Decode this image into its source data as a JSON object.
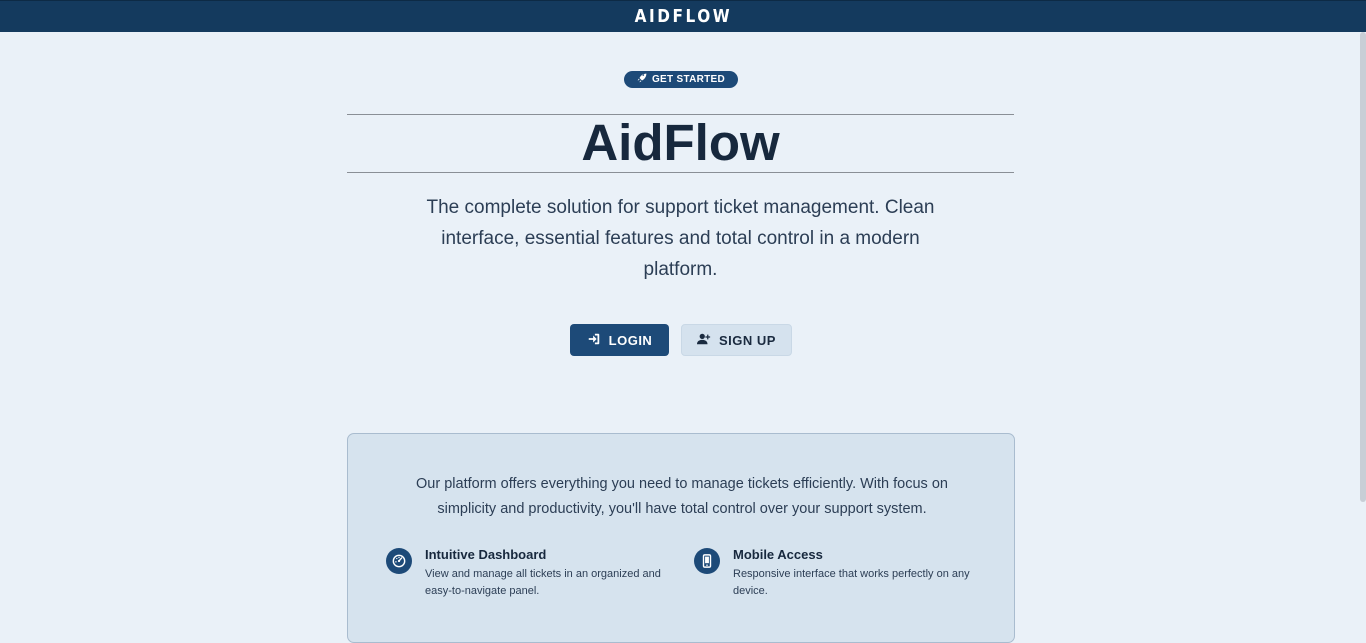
{
  "header": {
    "brand": "AIDFLOW"
  },
  "hero": {
    "badge_label": "GET STARTED",
    "title": "AidFlow",
    "subtitle": "The complete solution for support ticket management. Clean interface, essential features and total control in a modern platform.",
    "login_label": "LOGIN",
    "signup_label": "SIGN UP"
  },
  "info": {
    "text": "Our platform offers everything you need to manage tickets efficiently. With focus on simplicity and productivity, you'll have total control over your support system.",
    "features": [
      {
        "icon": "dashboard-icon",
        "title": "Intuitive Dashboard",
        "description": "View and manage all tickets in an organized and easy-to-navigate panel."
      },
      {
        "icon": "mobile-icon",
        "title": "Mobile Access",
        "description": "Responsive interface that works perfectly on any device."
      }
    ]
  },
  "colors": {
    "primary": "#1d4a78",
    "header_bg": "#143a5e",
    "page_bg": "#eaf1f8",
    "panel_bg": "#d6e3ee"
  }
}
